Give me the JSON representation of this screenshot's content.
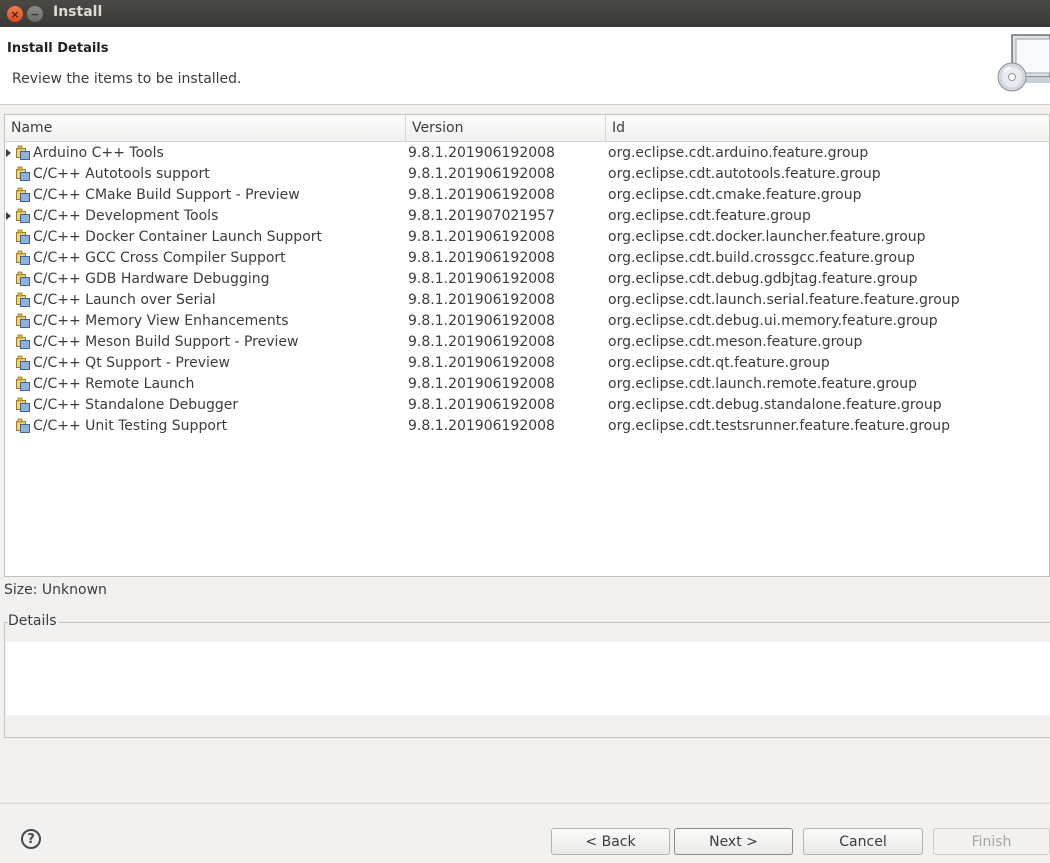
{
  "window": {
    "title": "Install",
    "close_glyph": "×",
    "minimize_glyph": "−"
  },
  "banner": {
    "title": "Install Details",
    "description": "Review the items to be installed.",
    "icon": "install-cd-computer-icon"
  },
  "table": {
    "columns": {
      "name": "Name",
      "version": "Version",
      "id": "Id"
    },
    "rows": [
      {
        "name": "Arduino C++ Tools",
        "version": "9.8.1.201906192008",
        "id": "org.eclipse.cdt.arduino.feature.group",
        "expandable": true
      },
      {
        "name": "C/C++ Autotools support",
        "version": "9.8.1.201906192008",
        "id": "org.eclipse.cdt.autotools.feature.group",
        "expandable": false
      },
      {
        "name": "C/C++ CMake Build Support - Preview",
        "version": "9.8.1.201906192008",
        "id": "org.eclipse.cdt.cmake.feature.group",
        "expandable": false
      },
      {
        "name": "C/C++ Development Tools",
        "version": "9.8.1.201907021957",
        "id": "org.eclipse.cdt.feature.group",
        "expandable": true
      },
      {
        "name": "C/C++ Docker Container Launch Support",
        "version": "9.8.1.201906192008",
        "id": "org.eclipse.cdt.docker.launcher.feature.group",
        "expandable": false
      },
      {
        "name": "C/C++ GCC Cross Compiler Support",
        "version": "9.8.1.201906192008",
        "id": "org.eclipse.cdt.build.crossgcc.feature.group",
        "expandable": false
      },
      {
        "name": "C/C++ GDB Hardware Debugging",
        "version": "9.8.1.201906192008",
        "id": "org.eclipse.cdt.debug.gdbjtag.feature.group",
        "expandable": false
      },
      {
        "name": "C/C++ Launch over Serial",
        "version": "9.8.1.201906192008",
        "id": "org.eclipse.cdt.launch.serial.feature.feature.group",
        "expandable": false
      },
      {
        "name": "C/C++ Memory View Enhancements",
        "version": "9.8.1.201906192008",
        "id": "org.eclipse.cdt.debug.ui.memory.feature.group",
        "expandable": false
      },
      {
        "name": "C/C++ Meson Build Support - Preview",
        "version": "9.8.1.201906192008",
        "id": "org.eclipse.cdt.meson.feature.group",
        "expandable": false
      },
      {
        "name": "C/C++ Qt Support - Preview",
        "version": "9.8.1.201906192008",
        "id": "org.eclipse.cdt.qt.feature.group",
        "expandable": false
      },
      {
        "name": "C/C++ Remote Launch",
        "version": "9.8.1.201906192008",
        "id": "org.eclipse.cdt.launch.remote.feature.group",
        "expandable": false
      },
      {
        "name": "C/C++ Standalone Debugger",
        "version": "9.8.1.201906192008",
        "id": "org.eclipse.cdt.debug.standalone.feature.group",
        "expandable": false
      },
      {
        "name": "C/C++ Unit Testing Support",
        "version": "9.8.1.201906192008",
        "id": "org.eclipse.cdt.testsrunner.feature.feature.group",
        "expandable": false
      }
    ]
  },
  "size_text": "Size: Unknown",
  "details": {
    "label": "Details",
    "content": ""
  },
  "footer": {
    "help_glyph": "?",
    "back_label": "< Back",
    "next_label": "Next >",
    "cancel_label": "Cancel",
    "finish_label": "Finish"
  },
  "colors": {
    "titlebar": "#3b3a36",
    "close_button": "#df4a16",
    "window_bg": "#f2f1f0"
  }
}
